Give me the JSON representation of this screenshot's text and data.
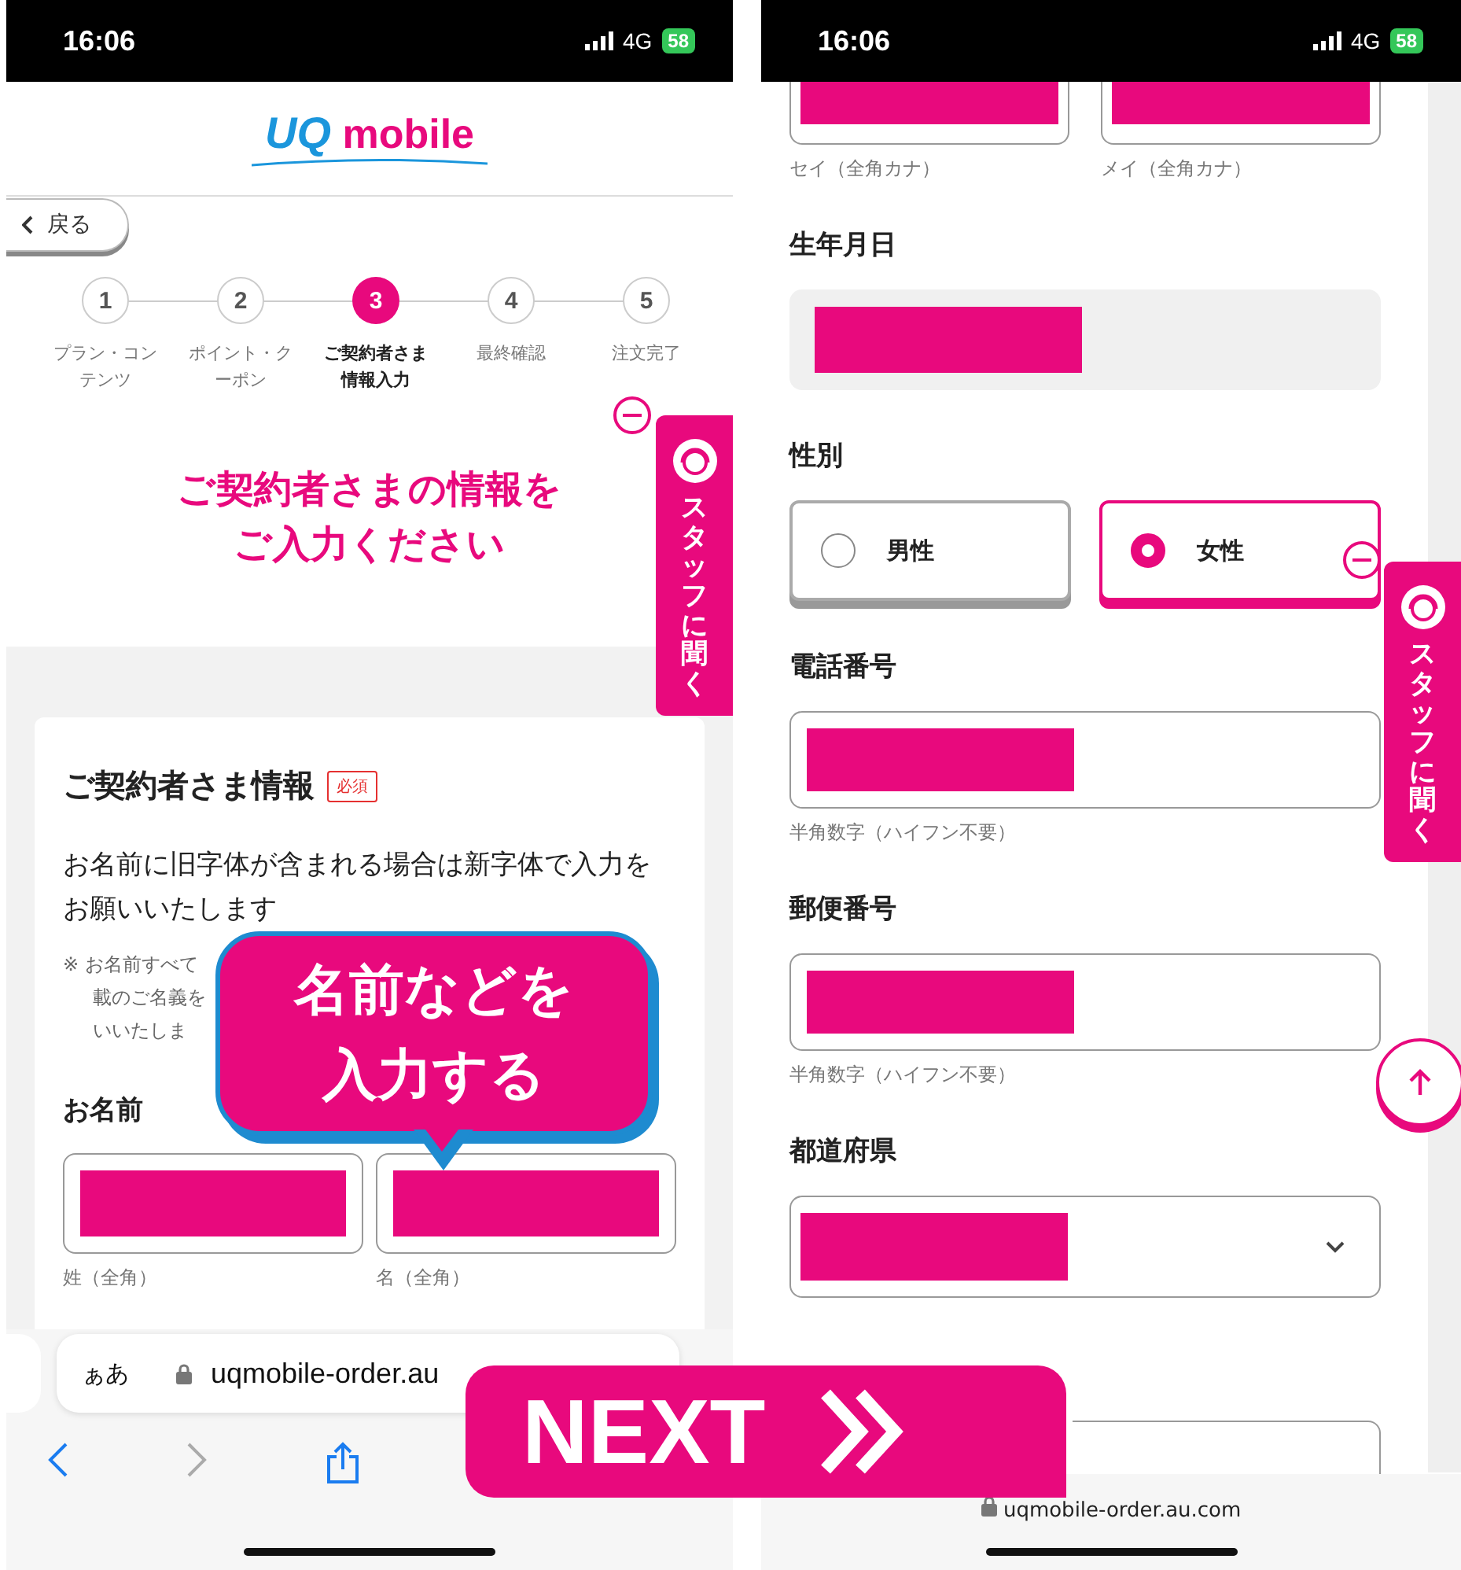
{
  "left_screen": {
    "status_bar": {
      "time": "16:06",
      "network": "4G",
      "battery": "58"
    },
    "logo": {
      "mark": "UQ",
      "word": "mobile"
    },
    "back_button": "戻る",
    "steps": [
      {
        "number": "1",
        "lines": [
          "プラン・コン",
          "テンツ"
        ],
        "selected": false
      },
      {
        "number": "2",
        "lines": [
          "ポイント・ク",
          "ーポン"
        ],
        "selected": false
      },
      {
        "number": "3",
        "lines": [
          "ご契約者さま",
          "情報入力"
        ],
        "selected": true
      },
      {
        "number": "4",
        "lines": [
          "最終確認"
        ],
        "selected": false
      },
      {
        "number": "5",
        "lines": [
          "注文完了"
        ],
        "selected": false
      }
    ],
    "page_title": [
      "ご契約者さまの情報を",
      "ご入力ください"
    ],
    "card": {
      "title": "ご契約者さま情報",
      "badge": "必須",
      "notice": "お名前に旧字体が含まれる場合は新字体で入力をお願いいたします",
      "note_lines": [
        "※ お名前すべて",
        "載のご名義を",
        "いいたしま"
      ],
      "name_label": "お名前",
      "name_fields": [
        {
          "hint": "姓（全角）"
        },
        {
          "hint": "名（全角）"
        }
      ]
    },
    "browser": {
      "text_size": "ぁあ",
      "url": "uqmobile-order.au"
    },
    "staff_tab": "スタッフに聞く"
  },
  "right_screen": {
    "status_bar": {
      "time": "16:06",
      "network": "4G",
      "battery": "58"
    },
    "kana_fields": [
      {
        "hint": "セイ（全角カナ）"
      },
      {
        "hint": "メイ（全角カナ）"
      }
    ],
    "sections": [
      {
        "kind": "date",
        "label": "生年月日"
      },
      {
        "kind": "radio",
        "label": "性別",
        "options": [
          {
            "label": "男性",
            "selected": false
          },
          {
            "label": "女性",
            "selected": true
          }
        ]
      },
      {
        "kind": "text",
        "label": "電話番号",
        "hint": "半角数字（ハイフン不要）"
      },
      {
        "kind": "text",
        "label": "郵便番号",
        "hint": "半角数字（ハイフン不要）"
      },
      {
        "kind": "select",
        "label": "都道府県"
      },
      {
        "kind": "cut"
      }
    ],
    "url": "uqmobile-order.au.com",
    "staff_tab": "スタッフに聞く"
  },
  "callout": [
    "名前などを",
    "入力する"
  ],
  "next_banner": "NEXT"
}
